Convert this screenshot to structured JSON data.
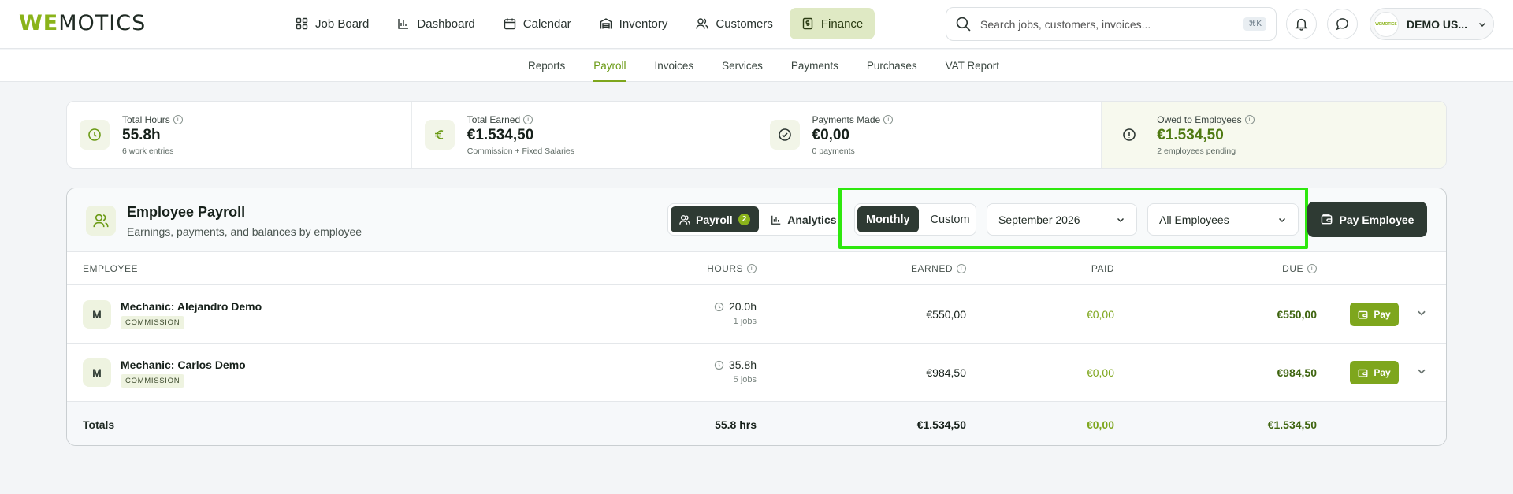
{
  "brand": {
    "logo_we": "WE",
    "logo_rest": "MOTICS"
  },
  "nav": [
    {
      "label": "Job Board",
      "icon": "grid-icon"
    },
    {
      "label": "Dashboard",
      "icon": "bar-chart-icon"
    },
    {
      "label": "Calendar",
      "icon": "calendar-icon"
    },
    {
      "label": "Inventory",
      "icon": "warehouse-icon"
    },
    {
      "label": "Customers",
      "icon": "users-icon"
    },
    {
      "label": "Finance",
      "icon": "receipt-icon",
      "active": true
    }
  ],
  "search": {
    "placeholder": "Search jobs, customers, invoices...",
    "shortcut": "⌘K"
  },
  "user": {
    "name": "DEMO US...",
    "avatar_text": "WEMOTICS"
  },
  "subnav": [
    "Reports",
    "Payroll",
    "Invoices",
    "Services",
    "Payments",
    "Purchases",
    "VAT Report"
  ],
  "subnav_active": "Payroll",
  "stats": [
    {
      "label": "Total Hours",
      "value": "55.8h",
      "sub": "6 work entries",
      "icon": "clock-icon"
    },
    {
      "label": "Total Earned",
      "value": "€1.534,50",
      "sub": "Commission + Fixed Salaries",
      "icon": "euro-icon"
    },
    {
      "label": "Payments Made",
      "value": "€0,00",
      "sub": "0 payments",
      "icon": "check-circle-icon"
    },
    {
      "label": "Owed to Employees",
      "value": "€1.534,50",
      "sub": "2 employees pending",
      "icon": "alert-circle-icon"
    }
  ],
  "payroll": {
    "title": "Employee Payroll",
    "subtitle": "Earnings, payments, and balances by employee",
    "view_tabs": {
      "payroll": "Payroll",
      "payroll_count": "2",
      "analytics": "Analytics"
    },
    "period": {
      "monthly": "Monthly",
      "custom": "Custom"
    },
    "month": "September 2026",
    "employee_filter": "All Employees",
    "pay_button": "Pay Employee",
    "columns": {
      "employee": "EMPLOYEE",
      "hours": "HOURS",
      "earned": "EARNED",
      "paid": "PAID",
      "due": "DUE"
    },
    "rows": [
      {
        "initial": "M",
        "name": "Mechanic: Alejandro Demo",
        "tag": "COMMISSION",
        "hours": "20.0h",
        "jobs": "1 jobs",
        "earned": "€550,00",
        "paid": "€0,00",
        "due": "€550,00",
        "pay": "Pay"
      },
      {
        "initial": "M",
        "name": "Mechanic: Carlos Demo",
        "tag": "COMMISSION",
        "hours": "35.8h",
        "jobs": "5 jobs",
        "earned": "€984,50",
        "paid": "€0,00",
        "due": "€984,50",
        "pay": "Pay"
      }
    ],
    "totals": {
      "label": "Totals",
      "hours": "55.8 hrs",
      "earned": "€1.534,50",
      "paid": "€0,00",
      "due": "€1.534,50"
    }
  },
  "colors": {
    "accent": "#7ea61d",
    "dark": "#2e3a33",
    "highlight": "#2ee80e"
  }
}
